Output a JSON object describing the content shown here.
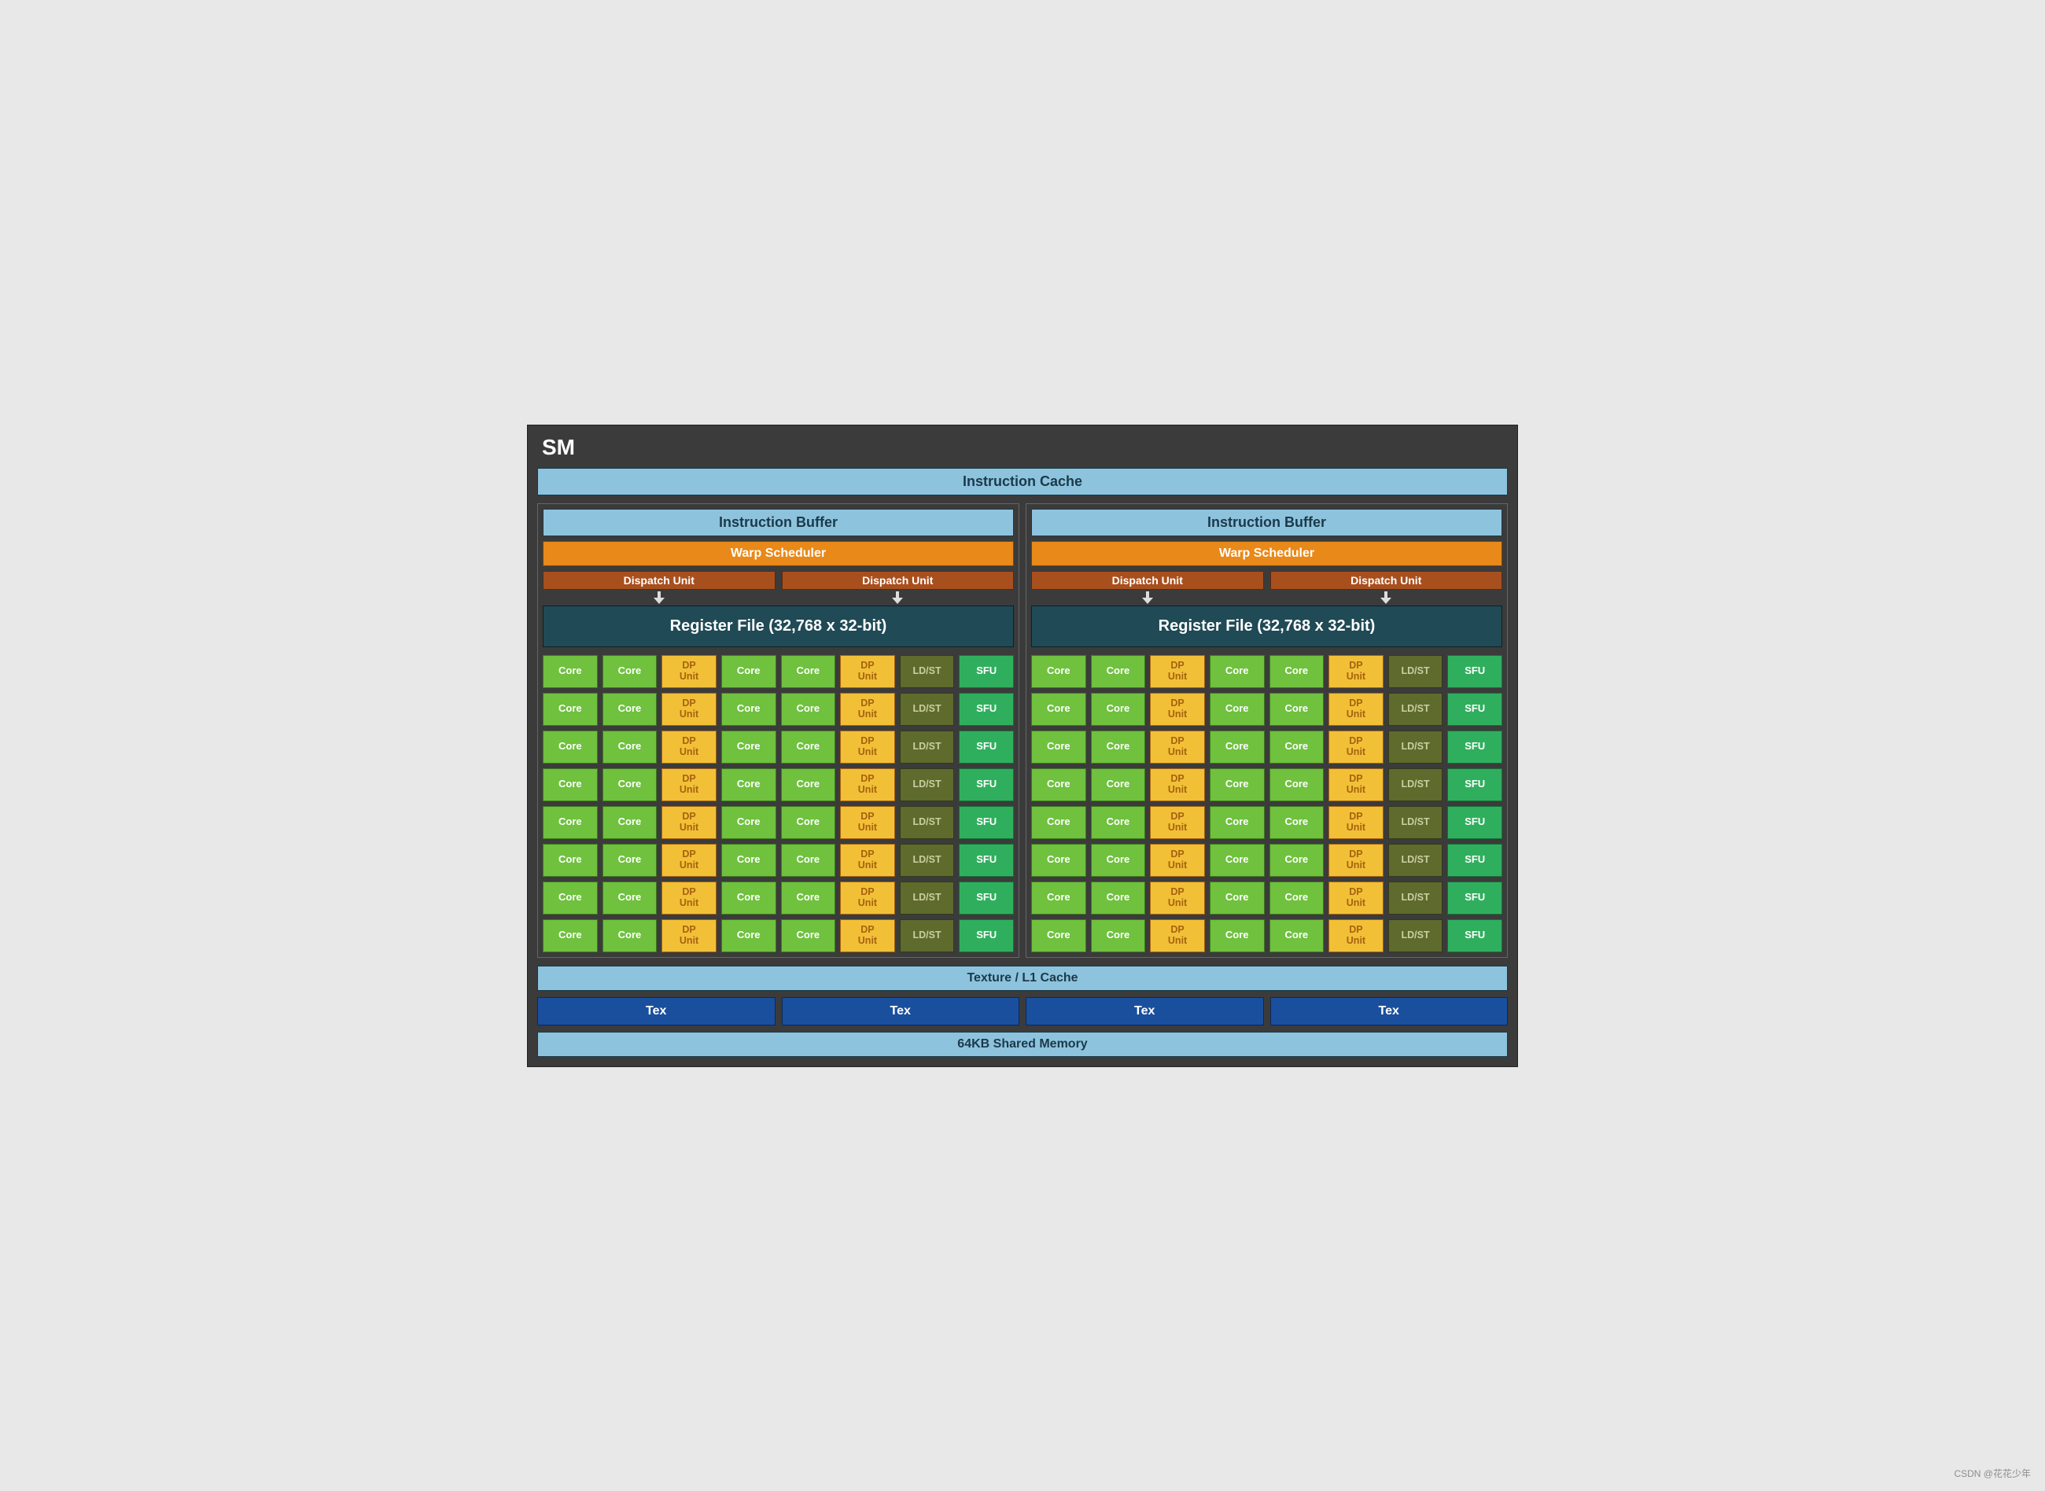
{
  "title": "SM",
  "instruction_cache": "Instruction Cache",
  "half": {
    "instruction_buffer": "Instruction Buffer",
    "warp_scheduler": "Warp Scheduler",
    "dispatch_unit": "Dispatch Unit",
    "register_file": "Register File (32,768 x 32-bit)",
    "units": {
      "core": "Core",
      "dp_unit": "DP\nUnit",
      "ldst": "LD/ST",
      "sfu": "SFU"
    },
    "row_pattern": [
      "core",
      "core",
      "dp_unit",
      "core",
      "core",
      "dp_unit",
      "ldst",
      "sfu"
    ],
    "rows": 8
  },
  "texture_cache": "Texture / L1 Cache",
  "tex_label": "Tex",
  "tex_count": 4,
  "shared_memory": "64KB Shared Memory",
  "watermark": "CSDN @花花少年",
  "colors": {
    "bg": "#3b3b3b",
    "light_blue": "#8ec3de",
    "orange": "#e8891a",
    "brown": "#a84f1e",
    "teal": "#204a55",
    "core_green": "#6fc13e",
    "dp_yellow": "#f2c037",
    "ldst_olive": "#5f6a2d",
    "sfu_green": "#2faf5d",
    "tex_blue": "#1a4f9e"
  }
}
